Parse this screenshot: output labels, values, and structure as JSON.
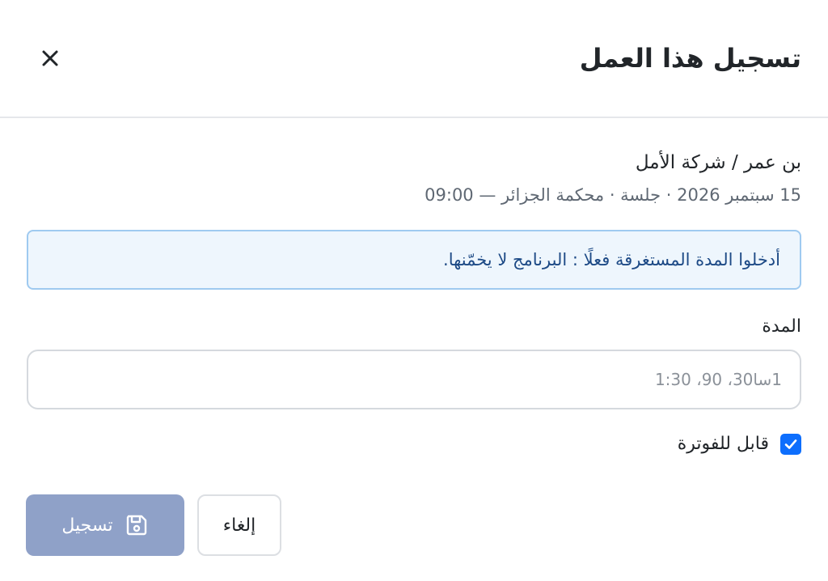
{
  "dialog": {
    "title": "تسجيل هذا العمل",
    "close_label": "×"
  },
  "matter": {
    "name": "بن عمر / شركة الأمل",
    "meta": "15 سبتمبر 2026 · جلسة · محكمة الجزائر — 09:00"
  },
  "notice": {
    "text": "أدخلوا المدة المستغرقة فعلًا : البرنامج لا يخمّنها."
  },
  "duration": {
    "label": "المدة",
    "value": "",
    "placeholder": "1سا30، 90، 1:30"
  },
  "billable": {
    "label": "قابل للفوترة",
    "checked": true
  },
  "actions": {
    "save_label": "تسجيل",
    "save_icon": "floppy-disk-icon",
    "cancel_label": "إلغاء"
  },
  "colors": {
    "primary": "#0d6efd",
    "save_button_disabled": "#8fa1c8",
    "alert_bg": "#eef6fd",
    "alert_border": "#9fcaf0",
    "alert_text": "#1d4a86"
  }
}
